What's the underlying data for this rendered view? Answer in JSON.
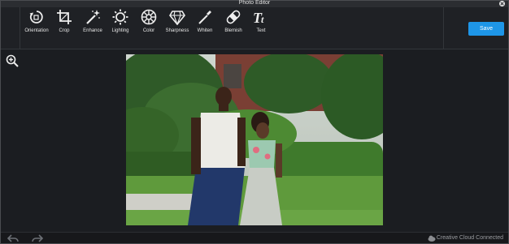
{
  "window": {
    "title": "Photo Editor"
  },
  "tools": [
    {
      "label": "Orientation",
      "icon": "orientation-icon"
    },
    {
      "label": "Crop",
      "icon": "crop-icon"
    },
    {
      "label": "Enhance",
      "icon": "enhance-wand-icon"
    },
    {
      "label": "Lighting",
      "icon": "lighting-sun-icon"
    },
    {
      "label": "Color",
      "icon": "color-icon"
    },
    {
      "label": "Sharpness",
      "icon": "sharpness-diamond-icon"
    },
    {
      "label": "Whiten",
      "icon": "whiten-brush-icon"
    },
    {
      "label": "Blemish",
      "icon": "blemish-bandage-icon"
    },
    {
      "label": "Text",
      "icon": "text-icon"
    }
  ],
  "save_label": "Save",
  "status": {
    "cloud_text": "Creative Cloud Connected"
  },
  "colors": {
    "accent": "#1e96e8",
    "background": "#1b1d21"
  }
}
